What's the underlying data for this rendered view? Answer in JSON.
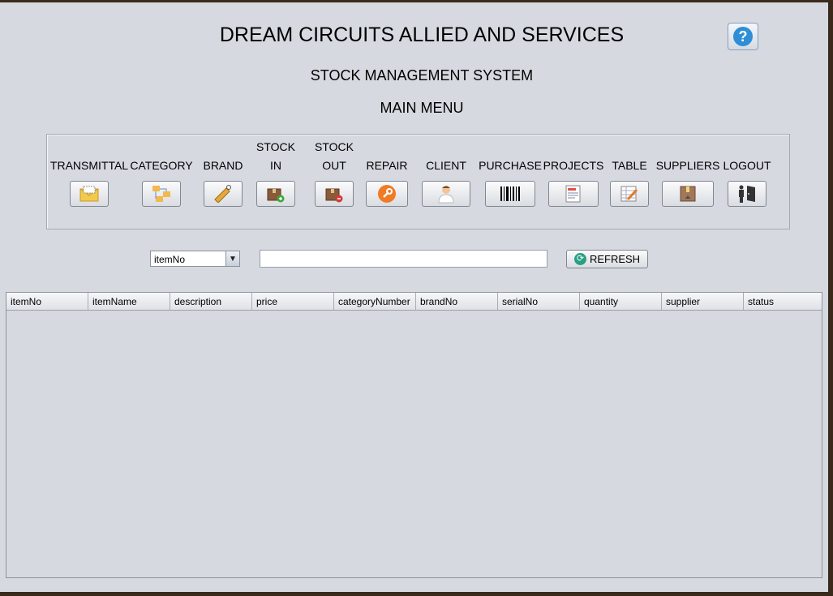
{
  "header": {
    "title": "DREAM CIRCUITS ALLIED AND SERVICES",
    "subtitle": "STOCK MANAGEMENT SYSTEM",
    "menu_title": "MAIN MENU",
    "help_label": "?"
  },
  "menu": [
    {
      "line1": "",
      "line2": "TRANSMITTAL",
      "icon": "envelope-icon"
    },
    {
      "line1": "",
      "line2": "CATEGORY",
      "icon": "category-icon"
    },
    {
      "line1": "",
      "line2": "BRAND",
      "icon": "tag-icon"
    },
    {
      "line1": "STOCK",
      "line2": "IN",
      "icon": "box-add-icon"
    },
    {
      "line1": "STOCK",
      "line2": "OUT",
      "icon": "box-remove-icon"
    },
    {
      "line1": "",
      "line2": "REPAIR",
      "icon": "wrench-icon"
    },
    {
      "line1": "",
      "line2": "CLIENT",
      "icon": "person-icon"
    },
    {
      "line1": "",
      "line2": "PURCHASE",
      "icon": "barcode-icon"
    },
    {
      "line1": "",
      "line2": "PROJECTS",
      "icon": "document-icon"
    },
    {
      "line1": "",
      "line2": "TABLE",
      "icon": "table-edit-icon"
    },
    {
      "line1": "",
      "line2": "SUPPLIERS",
      "icon": "package-icon"
    },
    {
      "line1": "",
      "line2": "LOGOUT",
      "icon": "logout-door-icon"
    }
  ],
  "search": {
    "field_selected": "itemNo",
    "query": "",
    "refresh_label": "REFRESH"
  },
  "table": {
    "columns": [
      "itemNo",
      "itemName",
      "description",
      "price",
      "categoryNumber",
      "brandNo",
      "serialNo",
      "quantity",
      "supplier",
      "status"
    ],
    "rows": []
  },
  "colors": {
    "window_bg": "#d6d9e0",
    "help_accent": "#2e8fd6",
    "refresh_accent": "#27a083"
  }
}
